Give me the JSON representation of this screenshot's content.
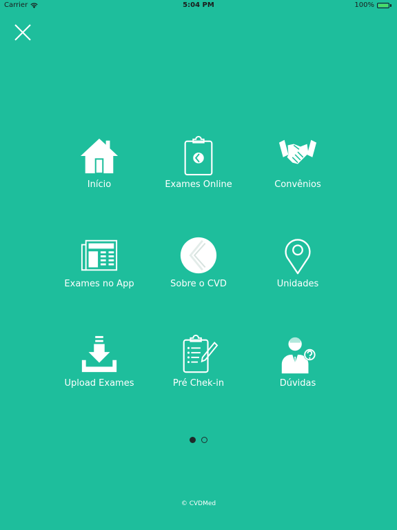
{
  "status_bar": {
    "carrier": "Carrier",
    "time": "5:04 PM",
    "battery": "100%"
  },
  "menu": {
    "items": [
      {
        "label": "Início",
        "icon": "home-icon"
      },
      {
        "label": "Exames Online",
        "icon": "clipboard-icon"
      },
      {
        "label": "Convênios",
        "icon": "handshake-icon"
      },
      {
        "label": "Exames no App",
        "icon": "newspaper-icon"
      },
      {
        "label": "Sobre o CVD",
        "icon": "cvd-logo-icon"
      },
      {
        "label": "Unidades",
        "icon": "map-pin-icon"
      },
      {
        "label": "Upload Exames",
        "icon": "download-tray-icon"
      },
      {
        "label": "Pré Chek-in",
        "icon": "checklist-pen-icon"
      },
      {
        "label": "Dúvidas",
        "icon": "help-person-icon"
      }
    ]
  },
  "pager": {
    "pages": 2,
    "current": 1
  },
  "footer": {
    "copyright": "© CVDMed"
  },
  "colors": {
    "background": "#1ebe9c",
    "foreground": "#ffffff",
    "pager_dot": "#1f2a2a",
    "battery": "#4cd964"
  }
}
